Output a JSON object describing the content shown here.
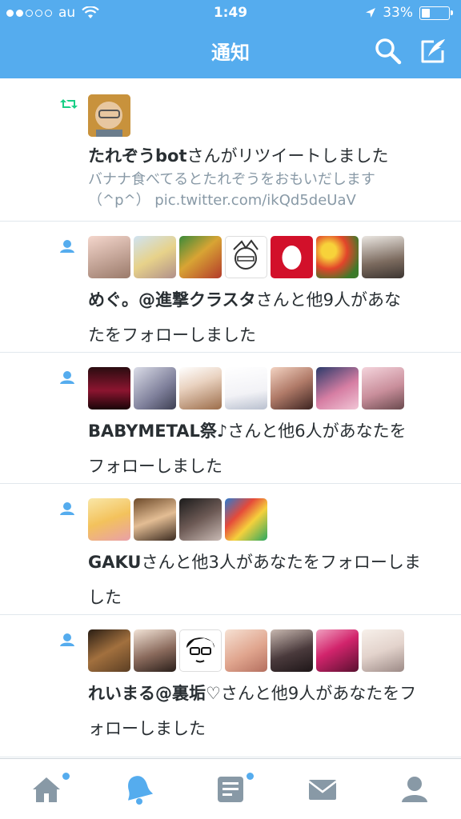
{
  "status_bar": {
    "carrier": "au",
    "time": "1:49",
    "battery": "33%",
    "battery_level": 0.33,
    "signal_bars_filled": 2,
    "signal_bars_total": 5
  },
  "nav": {
    "title": "通知",
    "search_icon": "search-icon",
    "compose_icon": "compose-icon"
  },
  "notifications": [
    {
      "kind": "retweet",
      "name": "たれぞうbot",
      "action": "さんがリツイートしました",
      "tweet_line1": "バナナ食べてるとたれぞうをおもいだします",
      "tweet_line2": "（^p^） pic.twitter.com/ikQd5deUaV",
      "avatar_count": 1
    },
    {
      "kind": "follow",
      "name": "めぐ。@進撃クラスタ",
      "action_line1": "さんと他9人があな",
      "action_line2": "たをフォローしました",
      "avatar_count": 7
    },
    {
      "kind": "follow",
      "name": "BABYMETAL祭♪",
      "action_line1": "さんと他6人があなたを",
      "action_line2": "フォローしました",
      "avatar_count": 7
    },
    {
      "kind": "follow",
      "name": "GAKU",
      "action_line1": "さんと他3人があなたをフォローしま",
      "action_line2": "した",
      "avatar_count": 4
    },
    {
      "kind": "follow",
      "name": "れいまる@裏垢♡",
      "action_line1": "さんと他9人があなたをフ",
      "action_line2": "ォローしました",
      "avatar_count": 7
    }
  ],
  "tabbar": {
    "tabs": [
      {
        "icon": "home-icon",
        "active": false,
        "badge": true
      },
      {
        "icon": "bell-icon",
        "active": true,
        "badge": false
      },
      {
        "icon": "moments-icon",
        "active": false,
        "badge": true
      },
      {
        "icon": "messages-icon",
        "active": false,
        "badge": false
      },
      {
        "icon": "profile-icon",
        "active": false,
        "badge": false
      }
    ]
  },
  "colors": {
    "brand": "#55acee",
    "icon_gray": "#8899a6",
    "retweet_green": "#19cf86",
    "text": "#292f33"
  }
}
